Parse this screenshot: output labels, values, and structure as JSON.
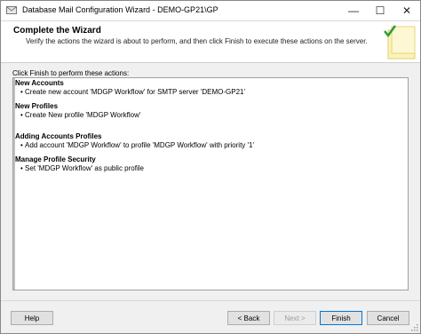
{
  "window": {
    "title": "Database Mail Configuration Wizard - DEMO-GP21\\GP",
    "minimize_label": "—",
    "maximize_label": "☐",
    "close_label": "✕"
  },
  "header": {
    "title": "Complete the Wizard",
    "subtitle": "Verify the actions the wizard is about to perform, and then click Finish to execute these actions on the server."
  },
  "prompt": "Click Finish to perform these actions:",
  "sections": [
    {
      "title": "New Accounts",
      "items": [
        "Create new account 'MDGP Workflow' for SMTP server 'DEMO-GP21'"
      ]
    },
    {
      "title": "New Profiles",
      "items": [
        "Create New profile 'MDGP Workflow'"
      ]
    },
    {
      "title": "Adding Accounts Profiles",
      "items": [
        "Add account 'MDGP Workflow' to profile 'MDGP Workflow' with priority '1'"
      ]
    },
    {
      "title": "Manage Profile Security",
      "items": [
        "Set 'MDGP Workflow' as public profile"
      ]
    }
  ],
  "buttons": {
    "help": "Help",
    "back": "< Back",
    "next": "Next >",
    "finish": "Finish",
    "cancel": "Cancel"
  },
  "icons": {
    "app": "database-mail-icon",
    "wizard_graphic": "wizard-checkmark-icon",
    "grip": "resize-grip-icon"
  }
}
